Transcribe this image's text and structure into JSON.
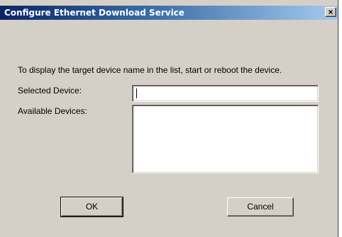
{
  "dialog": {
    "title": "Configure Ethernet Download Service",
    "close_glyph": "×",
    "close_icon": "close-icon",
    "instruction": "To display the target device name in the list, start or reboot the device.",
    "selected_device_label": "Selected Device:",
    "selected_device_value": "",
    "available_devices_label": "Available Devices:",
    "available_devices": [],
    "ok_label": "OK",
    "cancel_label": "Cancel"
  },
  "colors": {
    "titlebar_start": "#0a246a",
    "titlebar_end": "#a6caf0",
    "dialog_face": "#d4d0c8"
  }
}
